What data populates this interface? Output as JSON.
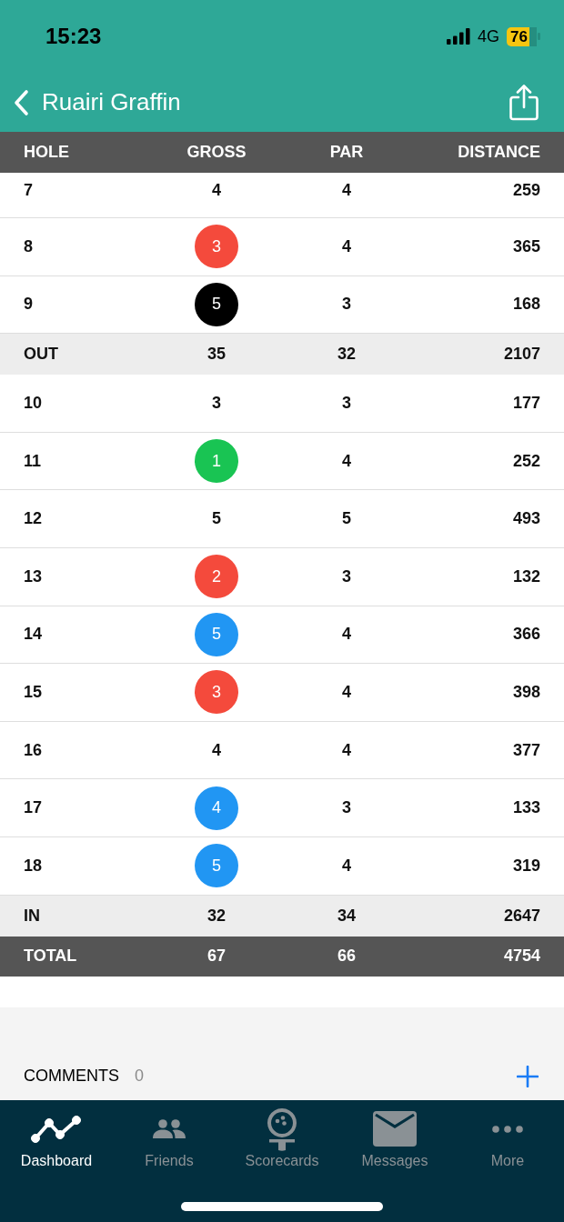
{
  "status_bar": {
    "time": "15:23",
    "network": "4G",
    "battery": "76"
  },
  "nav": {
    "title": "Ruairi Graffin"
  },
  "table": {
    "columns": [
      "HOLE",
      "GROSS",
      "PAR",
      "DISTANCE"
    ],
    "rows": [
      {
        "kind": "hole",
        "cells": [
          "7",
          "4",
          "4",
          "259"
        ]
      },
      {
        "kind": "hole",
        "cells": [
          "8",
          "3",
          "4",
          "365"
        ],
        "color": "#f44a3c"
      },
      {
        "kind": "hole",
        "cells": [
          "9",
          "5",
          "3",
          "168"
        ],
        "color": "#000000"
      },
      {
        "kind": "subtotal",
        "cells": [
          "OUT",
          "35",
          "32",
          "2107"
        ]
      },
      {
        "kind": "hole",
        "cells": [
          "10",
          "3",
          "3",
          "177"
        ]
      },
      {
        "kind": "hole",
        "cells": [
          "11",
          "1",
          "4",
          "252"
        ],
        "color": "#19c453"
      },
      {
        "kind": "hole",
        "cells": [
          "12",
          "5",
          "5",
          "493"
        ]
      },
      {
        "kind": "hole",
        "cells": [
          "13",
          "2",
          "3",
          "132"
        ],
        "color": "#f44a3c"
      },
      {
        "kind": "hole",
        "cells": [
          "14",
          "5",
          "4",
          "366"
        ],
        "color": "#2196f3"
      },
      {
        "kind": "hole",
        "cells": [
          "15",
          "3",
          "4",
          "398"
        ],
        "color": "#f44a3c"
      },
      {
        "kind": "hole",
        "cells": [
          "16",
          "4",
          "4",
          "377"
        ]
      },
      {
        "kind": "hole",
        "cells": [
          "17",
          "4",
          "3",
          "133"
        ],
        "color": "#2196f3"
      },
      {
        "kind": "hole",
        "cells": [
          "18",
          "5",
          "4",
          "319"
        ],
        "color": "#2196f3"
      },
      {
        "kind": "subtotal",
        "cells": [
          "IN",
          "32",
          "34",
          "2647"
        ]
      },
      {
        "kind": "total",
        "cells": [
          "TOTAL",
          "67",
          "66",
          "4754"
        ]
      }
    ]
  },
  "comments": {
    "label": "COMMENTS",
    "count": "0"
  },
  "tab_bar": [
    {
      "label": "Dashboard",
      "selected": true
    },
    {
      "label": "Friends",
      "selected": false
    },
    {
      "label": "Scorecards",
      "selected": false
    },
    {
      "label": "Messages",
      "selected": false
    },
    {
      "label": "More",
      "selected": false
    }
  ]
}
